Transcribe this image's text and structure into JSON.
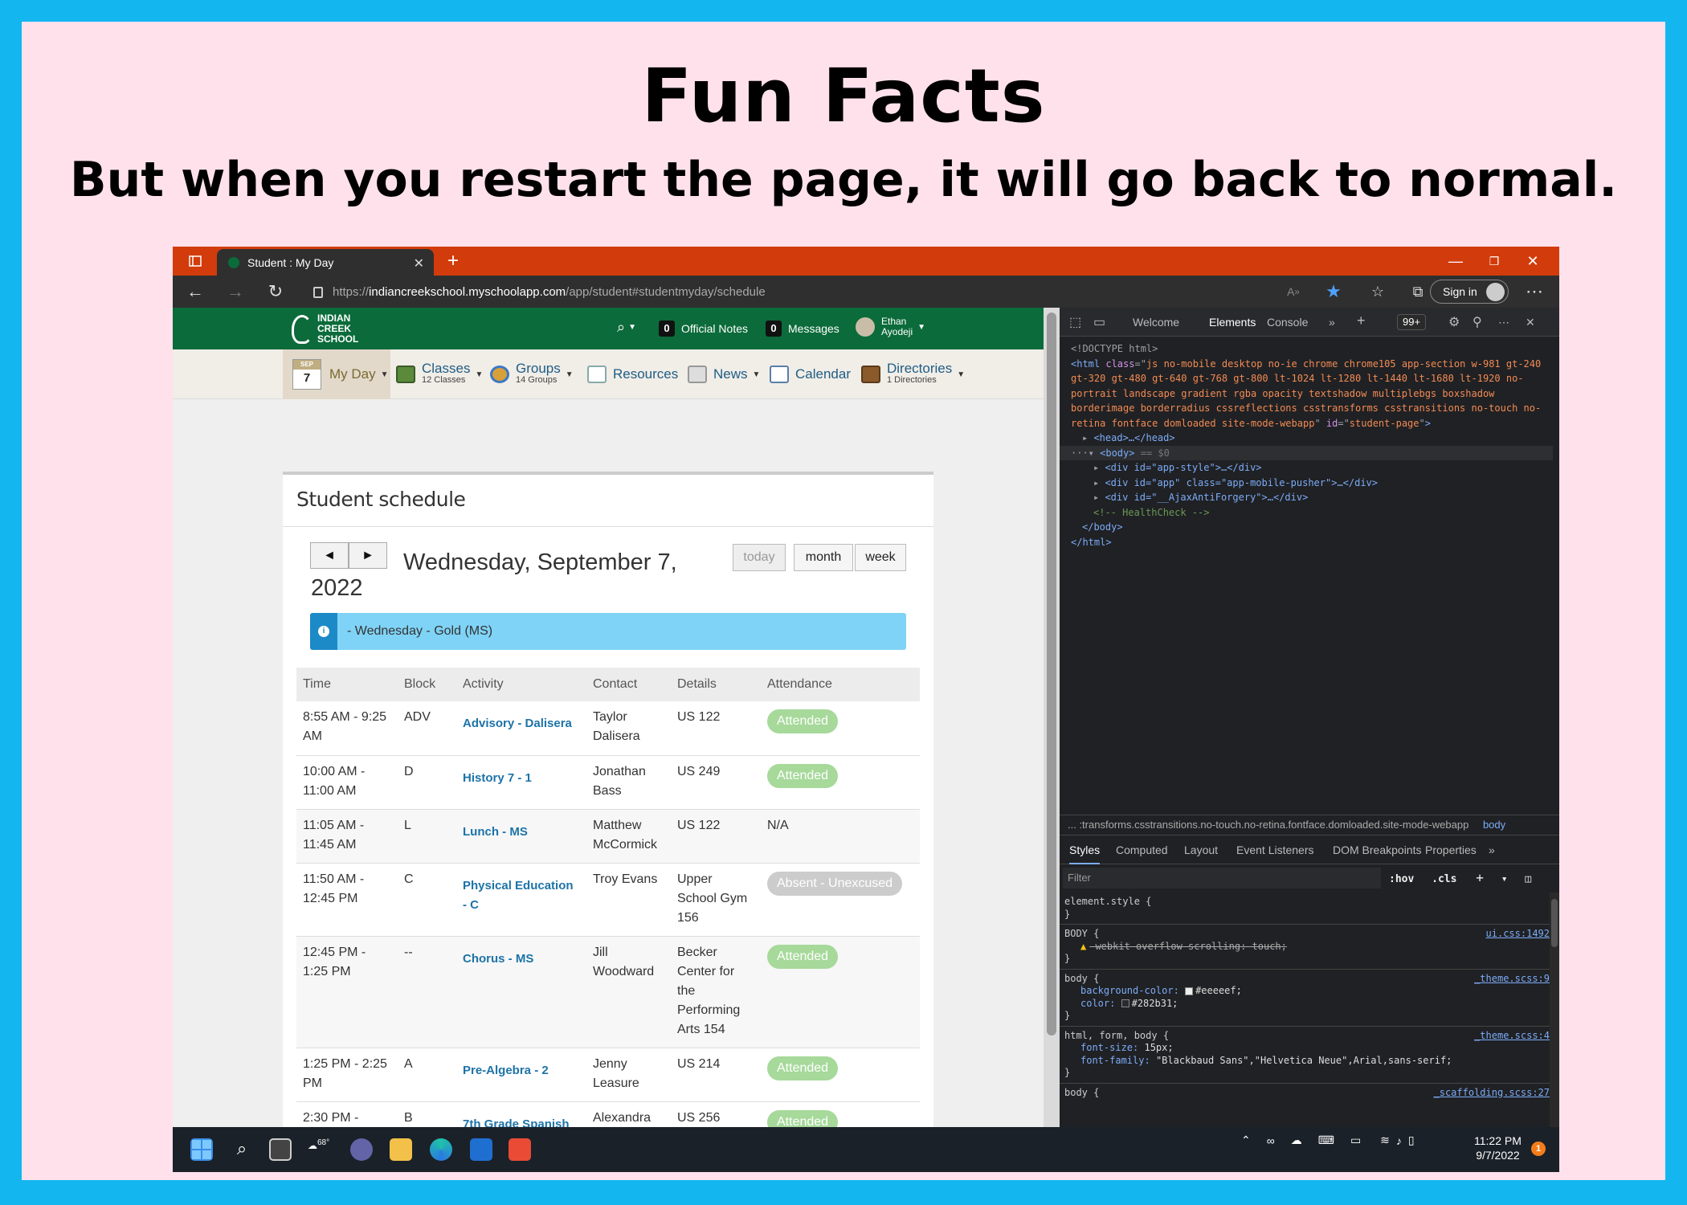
{
  "slide": {
    "title": "Fun Facts",
    "subtitle": "But when you restart the page, it will go back to normal."
  },
  "browser": {
    "tab_title": "Student : My Day",
    "url_prefix": "https://",
    "url_host": "indiancreekschool.myschoolapp.com",
    "url_path": "/app/student#studentmyday/schedule",
    "signin_label": "Sign in"
  },
  "app": {
    "logo_lines": [
      "INDIAN",
      "CREEK",
      "SCHOOL"
    ],
    "official_notes_count": "0",
    "official_notes_label": "Official Notes",
    "messages_count": "0",
    "messages_label": "Messages",
    "user_first": "Ethan",
    "user_last": "Ayodeji",
    "menu": {
      "myday_month": "SEP",
      "myday_day": "7",
      "myday_label": "My Day",
      "classes_label": "Classes",
      "classes_sub": "12 Classes",
      "groups_label": "Groups",
      "groups_sub": "14 Groups",
      "resources_label": "Resources",
      "news_label": "News",
      "calendar_label": "Calendar",
      "directories_label": "Directories",
      "directories_sub": "1 Directories"
    }
  },
  "schedule": {
    "heading": "Student schedule",
    "prev_glyph": "◄",
    "next_glyph": "►",
    "date": "Wednesday, September 7, 2022",
    "today_label": "today",
    "month_label": "month",
    "week_label": "week",
    "banner_text": "- Wednesday - Gold (MS)",
    "columns": [
      "Time",
      "Block",
      "Activity",
      "Contact",
      "Details",
      "Attendance"
    ],
    "rows": [
      {
        "time": "8:55 AM - 9:25 AM",
        "block": "ADV",
        "activity": "Advisory - Dalisera",
        "contact": "Taylor Dalisera",
        "details": "US 122",
        "attendance": "Attended"
      },
      {
        "time": "10:00 AM - 11:00 AM",
        "block": "D",
        "activity": "History 7 - 1",
        "contact": "Jonathan Bass",
        "details": "US 249",
        "attendance": "Attended"
      },
      {
        "time": "11:05 AM - 11:45 AM",
        "block": "L",
        "activity": "Lunch - MS",
        "contact": "Matthew McCormick",
        "details": "US 122",
        "attendance": "N/A"
      },
      {
        "time": "11:50 AM - 12:45 PM",
        "block": "C",
        "activity": "Physical Education - C",
        "contact": "Troy Evans",
        "details": "Upper School Gym 156",
        "attendance": "Absent - Unexcused"
      },
      {
        "time": "12:45 PM - 1:25 PM",
        "block": "--",
        "activity": "Chorus - MS",
        "contact": "Jill Woodward",
        "details": "Becker Center for the Performing Arts 154",
        "attendance": "Attended"
      },
      {
        "time": "1:25 PM - 2:25 PM",
        "block": "A",
        "activity": "Pre-Algebra - 2",
        "contact": "Jenny Leasure",
        "details": "US 214",
        "attendance": "Attended"
      },
      {
        "time": "2:30 PM -",
        "block": "B",
        "activity": "7th Grade Spanish",
        "contact": "Alexandra",
        "details": "US 256",
        "attendance": "Attended"
      }
    ]
  },
  "devtools": {
    "tab_welcome": "Welcome",
    "tab_elements": "Elements",
    "tab_console": "Console",
    "issues_badge": "99+",
    "dom": {
      "doctype": "<!DOCTYPE html>",
      "html_open": "<html",
      "class_attr": "class",
      "html_class": "js no-mobile desktop no-ie chrome chrome105 app-section w-981 gt-240 gt-320 gt-480 gt-640 gt-768 gt-800 lt-1024 lt-1280 lt-1440 lt-1680 lt-1920 no-portrait landscape gradient rgba opacity textshadow multiplebgs boxshadow borderimage borderradius cssreflections csstransforms csstransitions no-touch no-retina fontface domloaded site-mode-webapp",
      "id_attr": "id",
      "html_id": "student-page",
      "head": "<head>…</head>",
      "body_open": "<body>",
      "body_eq": "== $0",
      "div_app_style": "<div id=\"app-style\">…</div>",
      "div_app": "<div id=\"app\" class=\"app-mobile-pusher\">…</div>",
      "div_ajax": "<div id=\"__AjaxAntiForgery\">…</div>",
      "comment": "<!-- HealthCheck -->",
      "body_close": "</body>",
      "html_close": "</html>"
    },
    "crumb_path": "...  :transforms.csstransitions.no-touch.no-retina.fontface.domloaded.site-mode-webapp",
    "crumb_body": "body",
    "style_tabs": [
      "Styles",
      "Computed",
      "Layout",
      "Event Listeners",
      "DOM Breakpoints",
      "Properties"
    ],
    "filter_placeholder": "Filter",
    "hov_label": ":hov",
    "cls_label": ".cls",
    "rules": {
      "element_style": "element.style {",
      "close": "}",
      "body_upper": "BODY {",
      "src_ui": "ui.css:1492",
      "webkit_prop": "-webkit-overflow-scrolling: touch;",
      "body_lower": "body {",
      "src_theme9": "_theme.scss:9",
      "bg_prop": "background-color:",
      "bg_val": "#eeeeef;",
      "color_prop": "color:",
      "color_val": "#282b31;",
      "html_form_body": "html, form, body {",
      "src_theme4": "_theme.scss:4",
      "fs_prop": "font-size:",
      "fs_val": "15px;",
      "ff_prop": "font-family:",
      "ff_val": "\"Blackbaud Sans\",\"Helvetica Neue\",Arial,sans-serif;",
      "body_last": "body {",
      "src_scaff": "_scaffolding.scss:27"
    }
  },
  "taskbar": {
    "weather_temp": "68°",
    "time": "11:22 PM",
    "date": "9/7/2022",
    "notif_count": "1"
  },
  "colors": {
    "outer_border": "#13b6ef",
    "slide_bg": "#ffe1ec",
    "tab_strip": "#d23c0c",
    "app_green": "#0b6b3a",
    "attended": "#a6d99a",
    "banner": "#7fd3f6"
  }
}
